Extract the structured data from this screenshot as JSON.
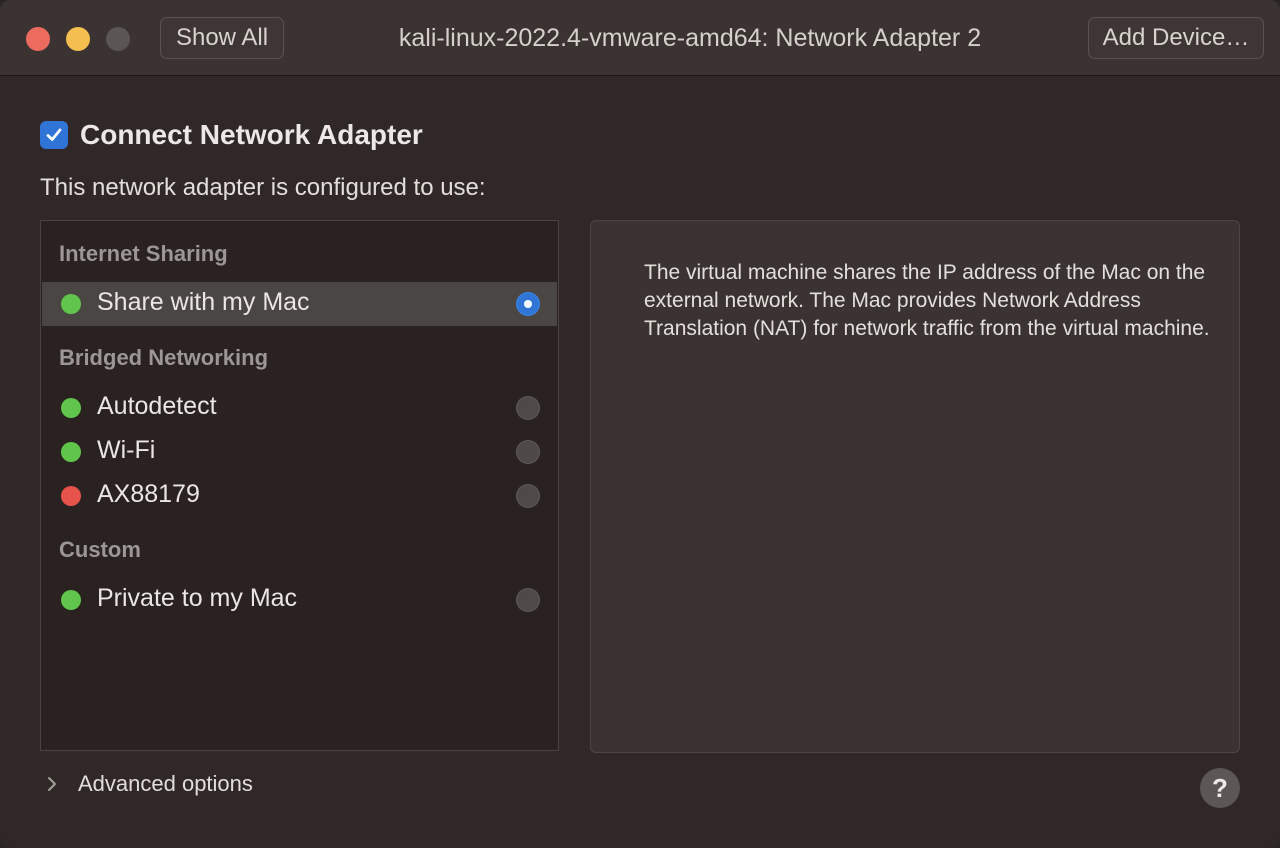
{
  "titlebar": {
    "title": "kali-linux-2022.4-vmware-amd64: Network Adapter 2",
    "show_all_label": "Show All",
    "add_device_label": "Add Device…"
  },
  "connect": {
    "label": "Connect Network Adapter",
    "checked": true
  },
  "config_label": "This network adapter is configured to use:",
  "sections": {
    "internet_sharing": "Internet Sharing",
    "bridged": "Bridged Networking",
    "custom": "Custom"
  },
  "items": {
    "share_with_mac": {
      "label": "Share with my Mac",
      "status": "green",
      "selected": true
    },
    "autodetect": {
      "label": "Autodetect",
      "status": "green",
      "selected": false
    },
    "wifi": {
      "label": "Wi-Fi",
      "status": "green",
      "selected": false
    },
    "ax88179": {
      "label": "AX88179",
      "status": "red",
      "selected": false
    },
    "private_to_mac": {
      "label": "Private to my Mac",
      "status": "green",
      "selected": false
    }
  },
  "description": "The virtual machine shares the IP address of the Mac on the external network. The Mac provides Network Address Translation (NAT) for network traffic from the virtual machine.",
  "advanced_label": "Advanced options",
  "help_label": "?",
  "colors": {
    "green": "#5fc64b",
    "red": "#e5534b",
    "accent": "#2f74d6"
  }
}
